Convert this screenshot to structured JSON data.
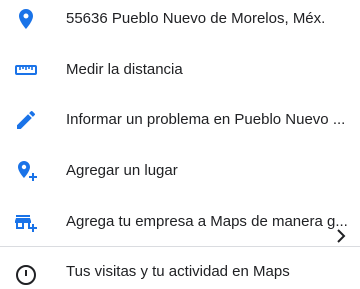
{
  "rows": [
    {
      "label": "55636 Pueblo Nuevo de Morelos, Méx.",
      "icon": "location-pin-icon"
    },
    {
      "label": "Medir la distancia",
      "icon": "ruler-icon"
    },
    {
      "label": "Informar un problema en Pueblo Nuevo ...",
      "icon": "pencil-icon"
    },
    {
      "label": "Agregar un lugar",
      "icon": "add-location-icon"
    },
    {
      "label": "Agrega tu empresa a Maps de manera g...",
      "icon": "add-business-icon"
    },
    {
      "label": "Tus visitas y tu actividad en Maps",
      "icon": "info-icon"
    }
  ],
  "colors": {
    "icon_blue": "#1a73e8",
    "text": "#202124",
    "divider": "#dadce0"
  }
}
